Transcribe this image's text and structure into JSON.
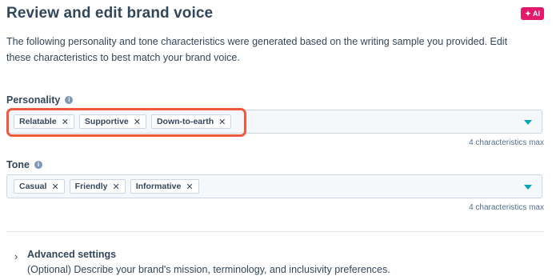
{
  "header": {
    "title": "Review and edit brand voice",
    "ai_badge": "✦ AI"
  },
  "description": "The following personality and tone characteristics were generated based on the writing sample you provided. Edit these characteristics to best match your brand voice.",
  "personality": {
    "label": "Personality",
    "tags": [
      "Relatable",
      "Supportive",
      "Down-to-earth"
    ],
    "max_note": "4 characteristics max",
    "highlight_color": "#ef5a3c"
  },
  "tone": {
    "label": "Tone",
    "tags": [
      "Casual",
      "Friendly",
      "Informative"
    ],
    "max_note": "4 characteristics max"
  },
  "advanced": {
    "title": "Advanced settings",
    "description": "(Optional) Describe your brand's mission, terminology, and inclusivity preferences."
  },
  "icons": {
    "info": "info-icon",
    "remove": "close-icon",
    "dropdown": "caret-down-icon",
    "expand": "chevron-right-icon"
  },
  "colors": {
    "accent": "#00a4bd",
    "ai_badge": "#e3196b",
    "text": "#33475b"
  }
}
